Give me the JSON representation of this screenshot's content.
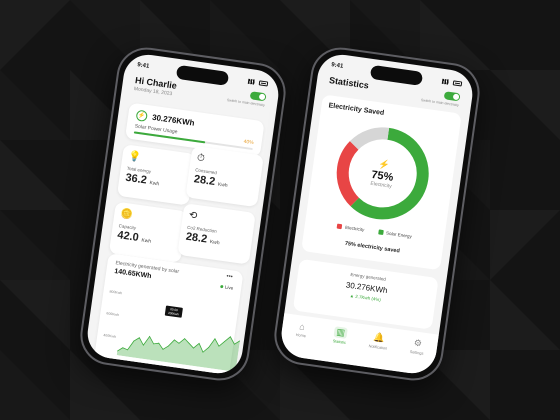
{
  "left_phone": {
    "status_time": "9:41",
    "greeting": "Hi Charlie",
    "date": "Monday 18, 2023",
    "toggle_label": "Switch to main electricity",
    "solar": {
      "icon": "bolt-icon",
      "value": "30.276KWh",
      "label": "Solar Power Usage",
      "percent_text": "40%",
      "progress": 0.6
    },
    "stats": [
      {
        "icon": "lightbulb-icon",
        "label": "Total energy",
        "value": "36.2",
        "unit": "Kwh"
      },
      {
        "icon": "meter-icon",
        "label": "Consumed",
        "value": "28.2",
        "unit": "Kwh"
      },
      {
        "icon": "coins-icon",
        "label": "Capacity",
        "value": "42.0",
        "unit": "Kwh"
      },
      {
        "icon": "reduction-icon",
        "label": "Co2 Reduction",
        "value": "28.2",
        "unit": "Kwh"
      }
    ],
    "generated": {
      "label": "Electricity generated by solar",
      "value": "140.65KWh",
      "live_label": "Live",
      "menu_icon": "dots-icon",
      "y_labels": [
        "800Kwh",
        "600Kwh",
        "400Kwh"
      ],
      "tooltip_line1": "09.00",
      "tooltip_line2": "200Kwh"
    },
    "chart_data": {
      "type": "area",
      "title": "Electricity generated by solar",
      "values": [
        380,
        410,
        400,
        470,
        500,
        450,
        520,
        470,
        480,
        440,
        470,
        520,
        500,
        540,
        510,
        480,
        520,
        460,
        500,
        570,
        520,
        560,
        600,
        550,
        580
      ],
      "ylim": [
        350,
        850
      ]
    }
  },
  "right_phone": {
    "status_time": "9:41",
    "title": "Statistics",
    "toggle_label": "Switch to main electricity",
    "saved": {
      "title": "Electricity Saved",
      "center_icon": "bolt-icon",
      "percent": "75%",
      "center_label": "Electricity",
      "caption": "75% electricity saved",
      "legend": [
        {
          "label": "Electricity",
          "color": "#e84545"
        },
        {
          "label": "Solar Energy",
          "color": "#3caa3c"
        }
      ]
    },
    "chart_data": {
      "type": "pie",
      "title": "Electricity Saved",
      "slices": [
        {
          "label": "Solar Energy",
          "value": 60,
          "color": "#3caa3c"
        },
        {
          "label": "Electricity",
          "value": 25,
          "color": "#e84545"
        },
        {
          "label": "Remaining",
          "value": 15,
          "color": "#d6d6d6"
        }
      ]
    },
    "energy_generated": {
      "label": "Energy generated",
      "value": "30.276KWh",
      "change": "▲ 2.7Kwh (4%)"
    },
    "tabs": [
      {
        "label": "Home",
        "icon": "home-icon",
        "active": false
      },
      {
        "label": "Statistic",
        "icon": "chart-icon",
        "active": true
      },
      {
        "label": "Notification",
        "icon": "bell-icon",
        "active": false
      },
      {
        "label": "Settings",
        "icon": "gear-icon",
        "active": false
      }
    ]
  },
  "colors": {
    "accent": "#3caa3c",
    "warning": "#e84545",
    "orange": "#e8a030",
    "background": "#141414"
  }
}
